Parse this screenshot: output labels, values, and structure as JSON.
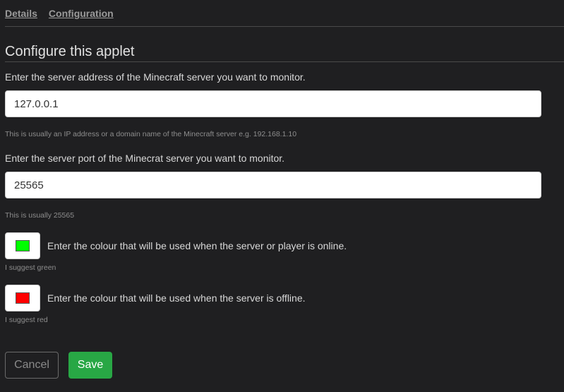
{
  "tabs": [
    {
      "label": "Details"
    },
    {
      "label": "Configuration"
    }
  ],
  "heading": "Configure this applet",
  "server_address": {
    "label": "Enter the server address of the Minecraft server you want to monitor.",
    "value": "127.0.0.1",
    "help": "This is usually an IP address or a domain name of the Minecraft server e.g. 192.168.1.10"
  },
  "server_port": {
    "label": "Enter the server port of the Minecrat server you want to monitor.",
    "value": "25565",
    "help": "This is usually 25565"
  },
  "online_colour": {
    "label": "Enter the colour that will be used when the server or player is online.",
    "color": "#00ff00",
    "help": "I suggest green"
  },
  "offline_colour": {
    "label": "Enter the colour that will be used when the server is offline.",
    "color": "#ff0000",
    "help": "I suggest red"
  },
  "buttons": {
    "cancel": "Cancel",
    "save": "Save"
  }
}
